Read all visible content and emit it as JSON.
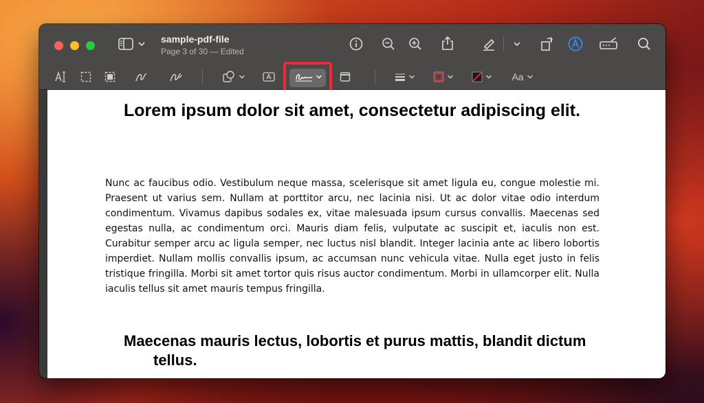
{
  "window": {
    "title": "sample-pdf-file",
    "subtitle": "Page 3 of 30 — Edited"
  },
  "toolbar": {
    "icons": [
      "sidebar-icon",
      "info-icon",
      "zoom-out-icon",
      "zoom-in-icon",
      "share-icon",
      "markup-pen-icon",
      "rotate-icon",
      "markup-circle-icon",
      "form-icon",
      "search-icon"
    ]
  },
  "markup_toolbar": {
    "text_style_label": "Aa",
    "highlighted_tool": "sign-tool",
    "border_color": "#ee2a3a"
  },
  "document": {
    "heading1": "Lorem ipsum dolor sit amet, consectetur adipiscing elit.",
    "paragraph": "Nunc ac faucibus odio. Vestibulum neque massa, scelerisque sit amet ligula eu, congue molestie mi. Praesent ut varius sem. Nullam at porttitor arcu, nec lacinia nisi. Ut ac dolor vitae odio interdum condimentum. Vivamus dapibus sodales ex, vitae malesuada ipsum cursus convallis. Maecenas sed egestas nulla, ac condimentum orci. Mauris diam felis, vulputate ac suscipit et, iaculis non est. Curabitur semper arcu ac ligula semper, nec luctus nisl blandit. Integer lacinia ante ac libero lobortis imperdiet. Nullam mollis convallis ipsum, ac accumsan nunc vehicula vitae. Nulla eget justo in felis tristique fringilla. Morbi sit amet tortor quis risus auctor condimentum. Morbi in ullamcorper elit. Nulla iaculis tellus sit amet mauris tempus fringilla.",
    "heading2": "Maecenas mauris lectus, lobortis et purus mattis, blandit dictum tellus."
  }
}
